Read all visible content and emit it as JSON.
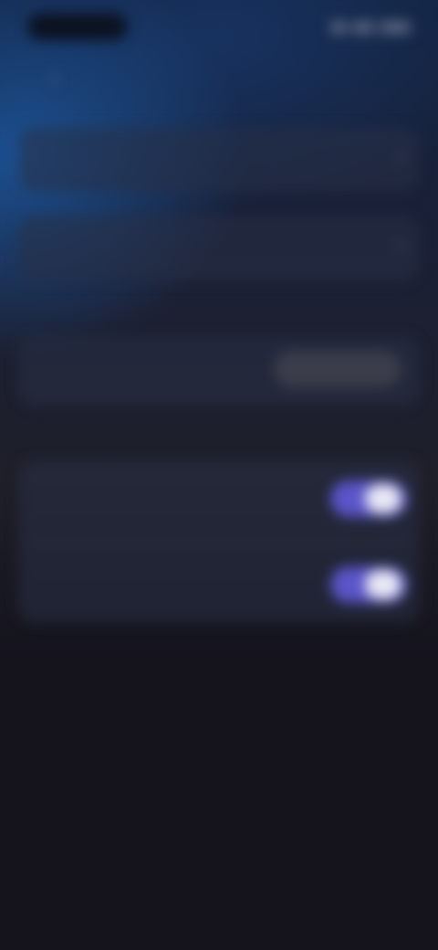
{
  "status_bar": {
    "time": "",
    "icons": [
      "signal-icon",
      "wifi-icon",
      "battery-icon"
    ]
  },
  "header": {
    "title": "",
    "back_icon": "chevron-left-icon"
  },
  "rows": {
    "row1": {
      "label": "",
      "chevron": "›"
    },
    "row2": {
      "label": "",
      "value": "",
      "chevron": "›"
    },
    "caption1": "",
    "row3": {
      "label": "",
      "pill_value": ""
    },
    "caption2": "",
    "toggle1": {
      "label": "",
      "on": true
    },
    "toggle2": {
      "label": "",
      "on": true
    }
  },
  "colors": {
    "accent": "#5a55c8",
    "knob": "#e8e8f4",
    "background": "#15141d"
  }
}
